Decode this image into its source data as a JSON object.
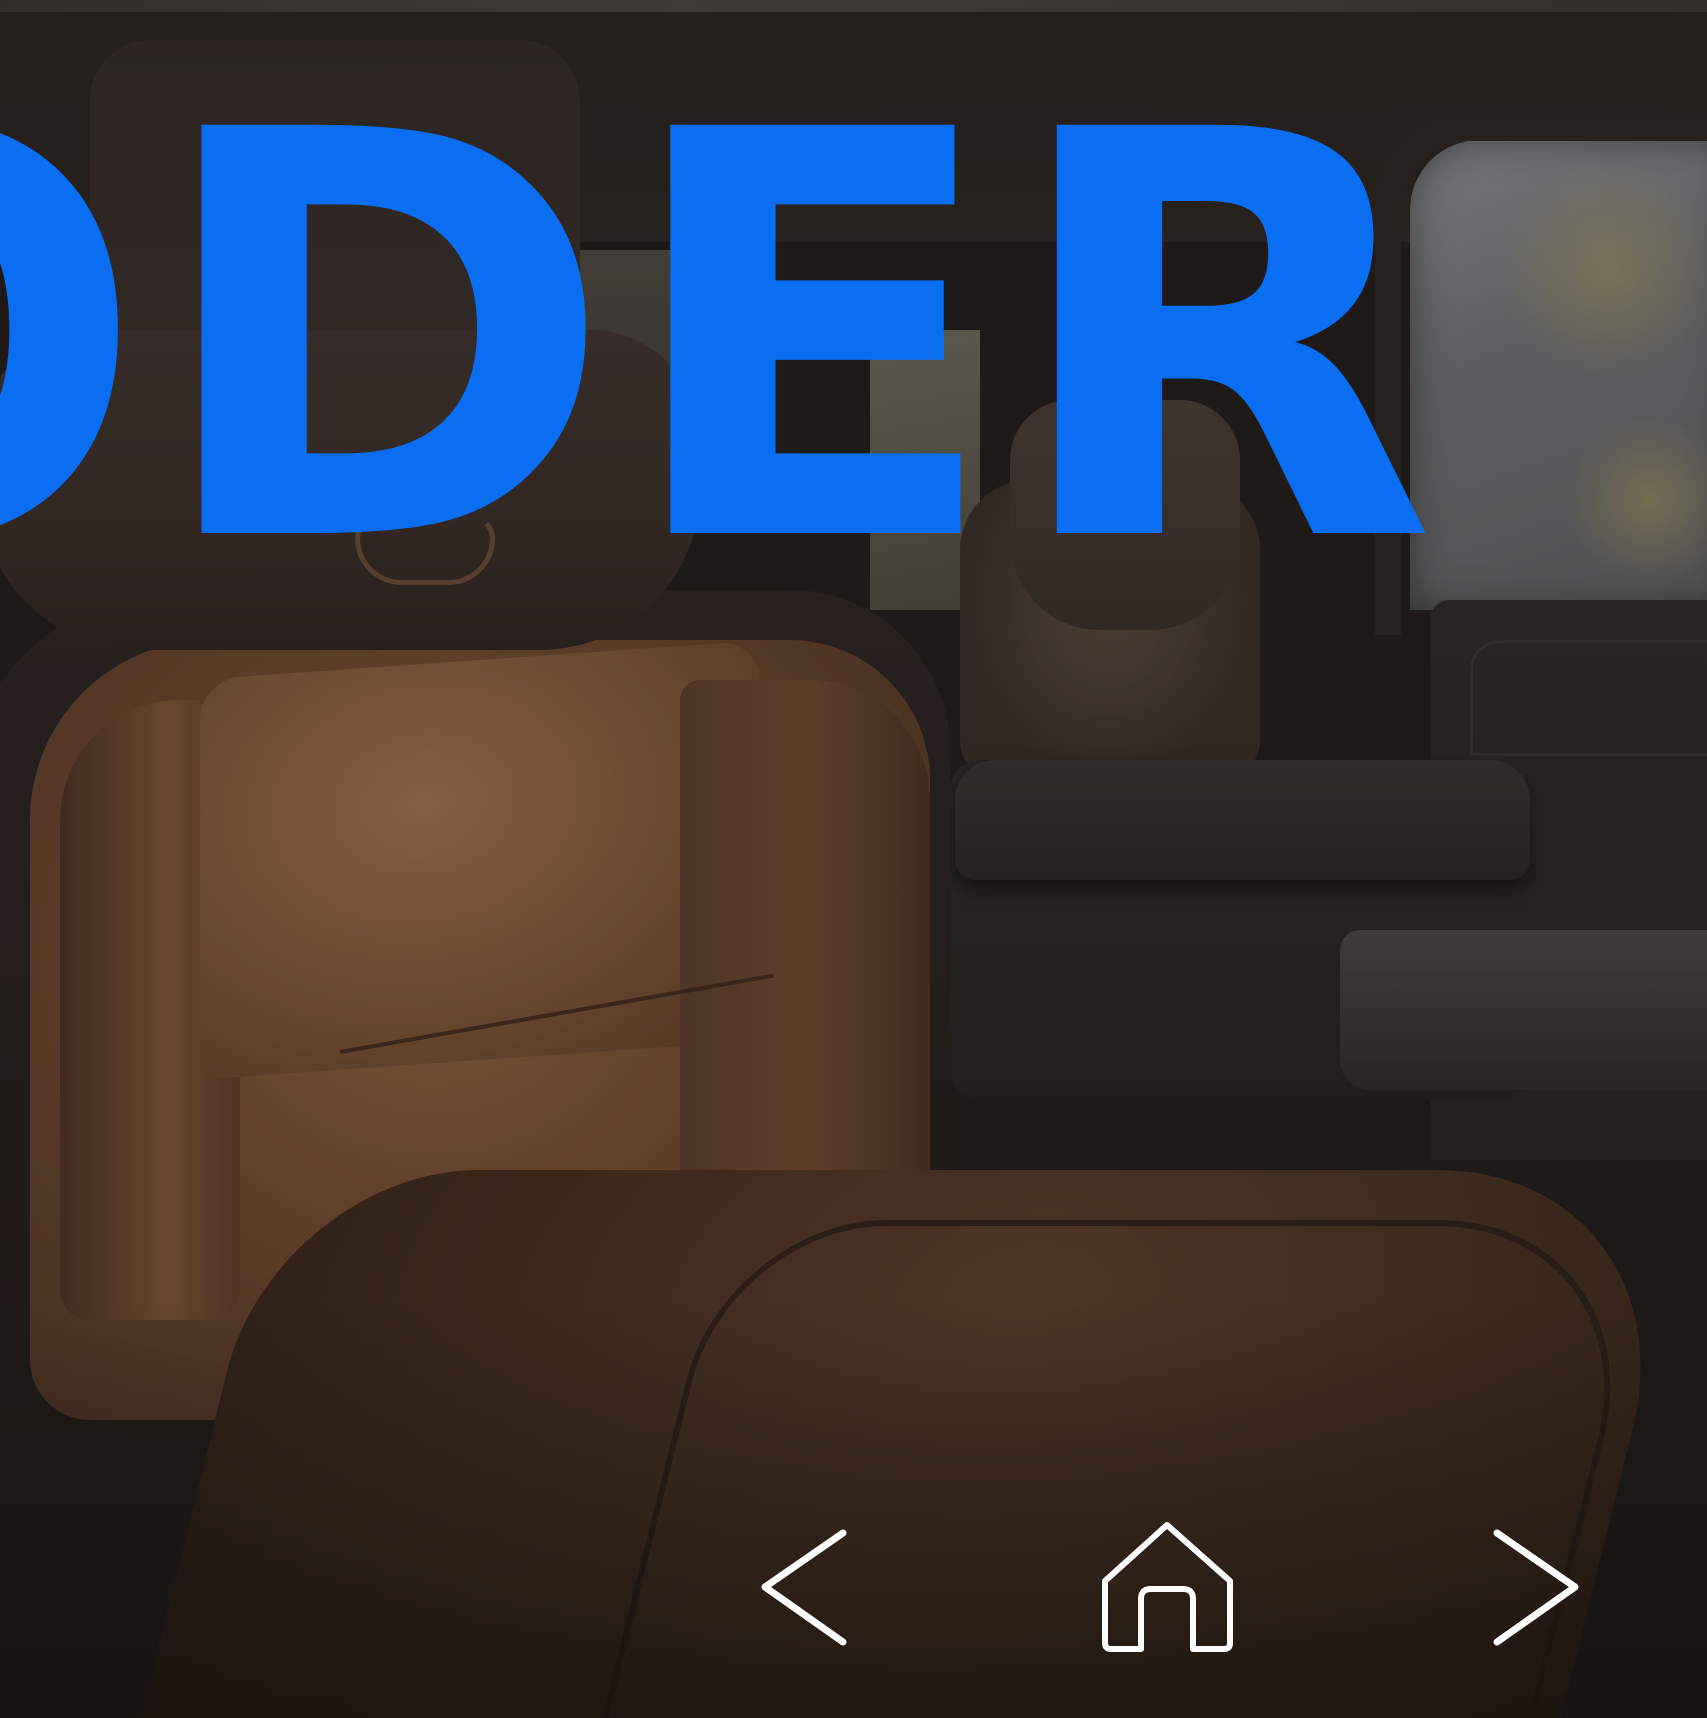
{
  "hero": {
    "headline": "ODER",
    "headline_color": "#0a6ef2"
  },
  "navigation": {
    "prev_icon": "chevron-left-icon",
    "home_icon": "home-icon",
    "next_icon": "chevron-right-icon",
    "icon_color": "#ffffff"
  }
}
